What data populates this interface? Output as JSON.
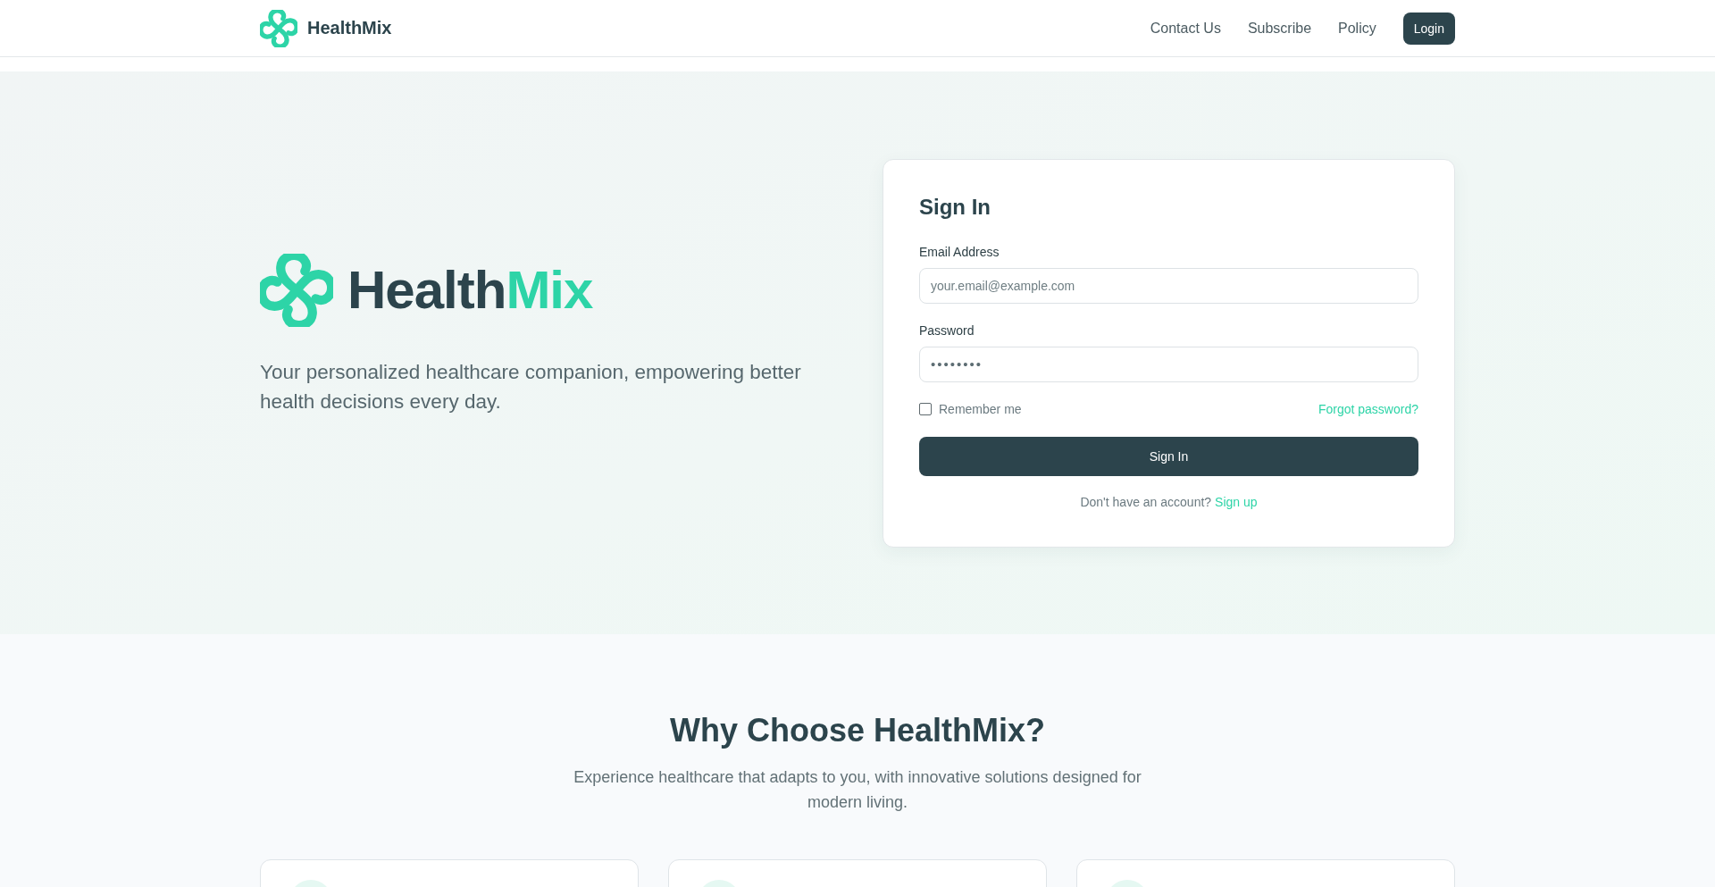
{
  "header": {
    "brand": "HealthMix",
    "nav": [
      {
        "label": "Contact Us",
        "kind": "link"
      },
      {
        "label": "Subscribe",
        "kind": "link"
      },
      {
        "label": "Policy",
        "kind": "link"
      },
      {
        "label": "Login",
        "kind": "button"
      }
    ]
  },
  "hero": {
    "brand_parts": [
      {
        "text": "Health",
        "kind": "dark"
      },
      {
        "text": "Mix",
        "kind": "accent"
      }
    ],
    "tagline": "Your personalized healthcare companion, empowering better health decisions every day."
  },
  "sign_in": {
    "title": "Sign In",
    "fields": [
      {
        "label": "Email Address",
        "placeholder": "your.email@example.com",
        "kind": "text"
      },
      {
        "label": "Password",
        "value": "••••••••",
        "kind": "password"
      }
    ],
    "remember_me": {
      "label": "Remember me",
      "checked": false
    },
    "forgot_link": "Forgot password?",
    "submit": "Sign In",
    "signup_prompt": "Don't have an account?",
    "signup_link": "Sign up"
  },
  "features": {
    "title": "Why Choose HealthMix?",
    "subtitle": "Experience healthcare that adapts to you, with innovative solutions designed for modern living.",
    "cards": [
      {
        "has_icon": true
      },
      {
        "has_icon": true
      },
      {
        "has_icon": true
      }
    ]
  }
}
